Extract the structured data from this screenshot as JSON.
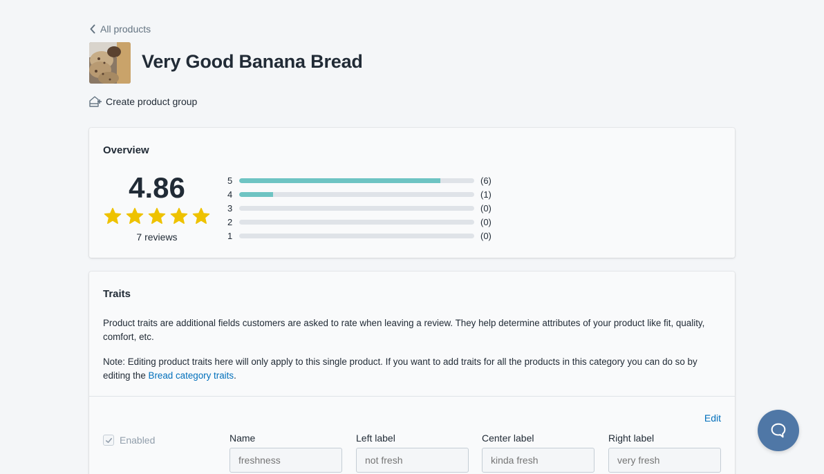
{
  "nav": {
    "back_label": "All products"
  },
  "product": {
    "title": "Very Good Banana Bread"
  },
  "actions": {
    "create_group_label": "Create product group"
  },
  "overview": {
    "title": "Overview",
    "average": "4.86",
    "star_rating": 4.86,
    "reviews_label": "7 reviews",
    "star_color": "#eec200",
    "bar_color": "#6ec4c3",
    "distribution": [
      {
        "stars": "5",
        "count_label": "(6)",
        "fraction": 0.857
      },
      {
        "stars": "4",
        "count_label": "(1)",
        "fraction": 0.143
      },
      {
        "stars": "3",
        "count_label": "(0)",
        "fraction": 0
      },
      {
        "stars": "2",
        "count_label": "(0)",
        "fraction": 0
      },
      {
        "stars": "1",
        "count_label": "(0)",
        "fraction": 0
      }
    ]
  },
  "traits": {
    "title": "Traits",
    "description": "Product traits are additional fields customers are asked to rate when leaving a review. They help determine attributes of your product like fit, quality, comfort, etc.",
    "note_before": "Note: Editing product traits here will only apply to this single product. If you want to add traits for all the products in this category you can do so by editing the ",
    "note_link": "Bread category traits",
    "note_after": ".",
    "edit_label": "Edit",
    "enabled_label": "Enabled",
    "fields": [
      {
        "label": "Name",
        "placeholder": "freshness"
      },
      {
        "label": "Left label",
        "placeholder": "not fresh"
      },
      {
        "label": "Center label",
        "placeholder": "kinda fresh"
      },
      {
        "label": "Right label",
        "placeholder": "very fresh"
      }
    ]
  },
  "colors": {
    "link": "#006fbb",
    "chat_button": "#4f77a6"
  }
}
